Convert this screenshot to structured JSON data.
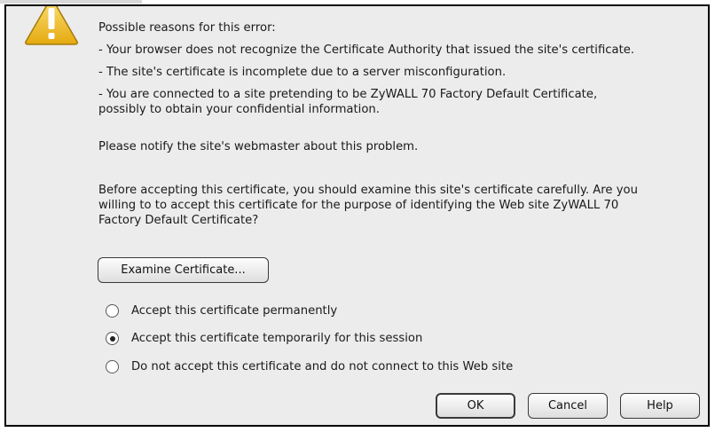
{
  "dialog": {
    "reasons_heading": "Possible reasons for this error:",
    "reasons": [
      "- Your browser does not recognize the Certificate Authority that issued the site's certificate.",
      "- The site's certificate is incomplete due to a server misconfiguration.",
      "- You are connected to a site pretending to be ZyWALL 70 Factory Default Certificate,",
      "possibly to obtain your confidential information."
    ],
    "notify_text": "Please notify the site's webmaster about this problem.",
    "examine_paragraph": [
      "Before accepting this certificate, you should examine this site's certificate carefully. Are you",
      "willing to to accept this certificate for the purpose of identifying the Web site ZyWALL 70",
      "Factory Default Certificate?"
    ],
    "examine_button_label": "Examine Certificate...",
    "options": [
      {
        "label": "Accept this certificate permanently",
        "selected": false
      },
      {
        "label": "Accept this certificate temporarily for this session",
        "selected": true
      },
      {
        "label": "Do not accept this certificate and do not connect to this Web site",
        "selected": false
      }
    ],
    "buttons": {
      "ok": "OK",
      "cancel": "Cancel",
      "help": "Help"
    },
    "icon": "warning-icon",
    "colors": {
      "dialog_bg": "#ececec",
      "warning_yellow": "#f2c21b",
      "border": "#000000"
    }
  }
}
